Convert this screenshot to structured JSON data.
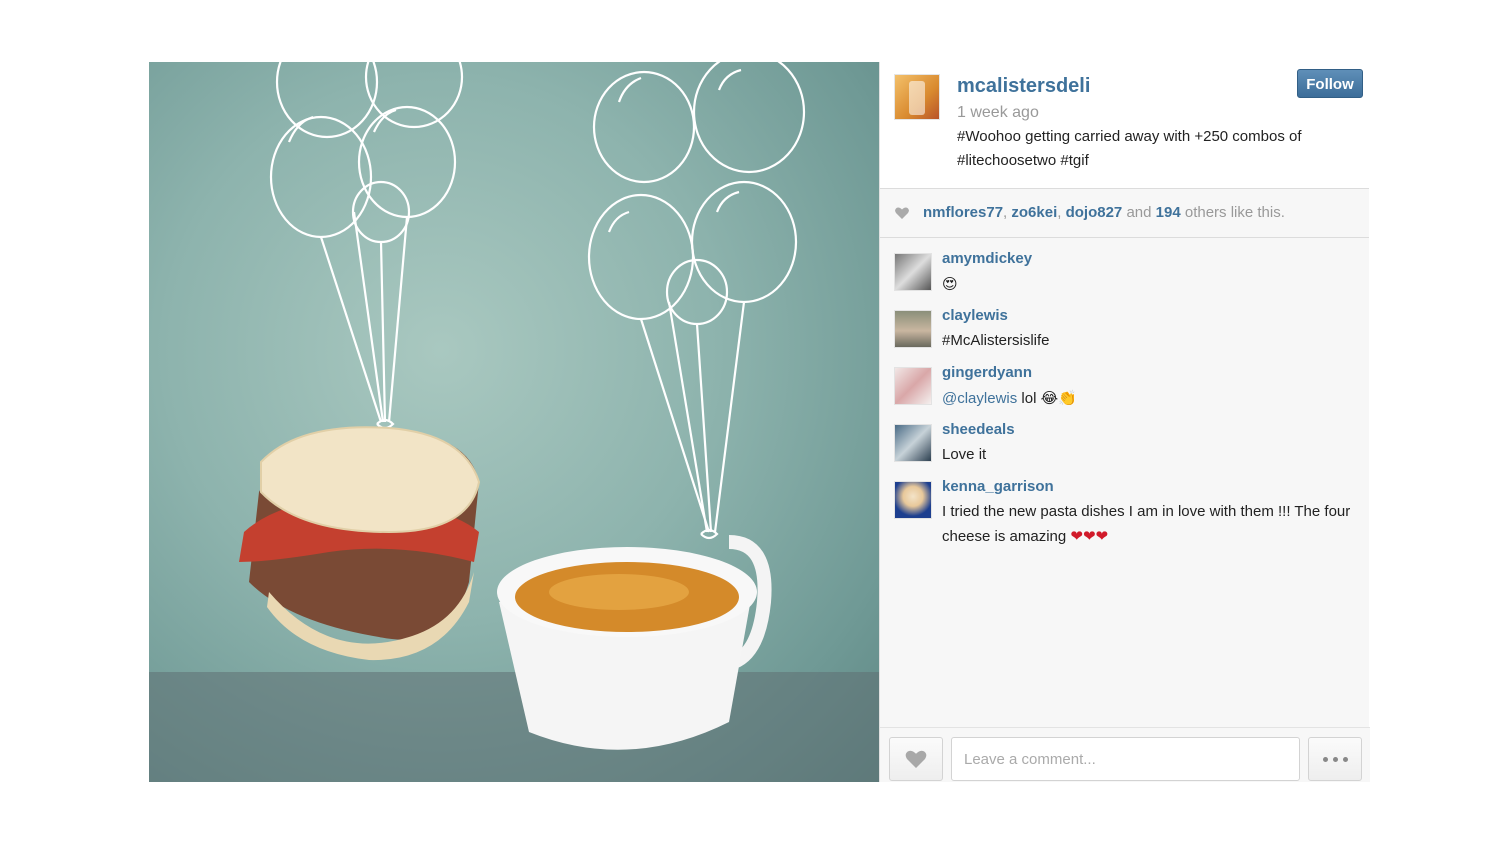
{
  "post": {
    "username": "mcalistersdeli",
    "time": "1 week ago",
    "caption": "#Woohoo getting carried away with +250 combos of #litechoosetwo #tgif",
    "follow_label": "Follow",
    "image_alt": "Sandwich and soup cup floating with drawn balloons"
  },
  "likes": {
    "user1": "nmflores77",
    "sep1": ", ",
    "user2": "zo6kei",
    "sep2": ", ",
    "user3": "dojo827",
    "and": " and ",
    "count": "194",
    "tail": " others like this."
  },
  "comments": [
    {
      "user": "amymdickey",
      "text": "😍"
    },
    {
      "user": "claylewis",
      "text": "#McAlistersislife"
    },
    {
      "user": "gingerdyann",
      "mention": "@claylewis",
      "text": " lol ",
      "emoji": "😂👏"
    },
    {
      "user": "sheedeals",
      "text": "Love it"
    },
    {
      "user": "kenna_garrison",
      "text": "I tried the new pasta dishes I am in love with them !!! The four cheese is amazing ",
      "emoji": "❤❤❤"
    }
  ],
  "footer": {
    "comment_placeholder": "Leave a comment...",
    "comment_value": ""
  },
  "colors": {
    "link": "#3f729b",
    "follow_bg": "#3c6d99",
    "muted": "#999999"
  },
  "icons": {
    "like": "heart-icon",
    "more": "more-dots-icon"
  }
}
